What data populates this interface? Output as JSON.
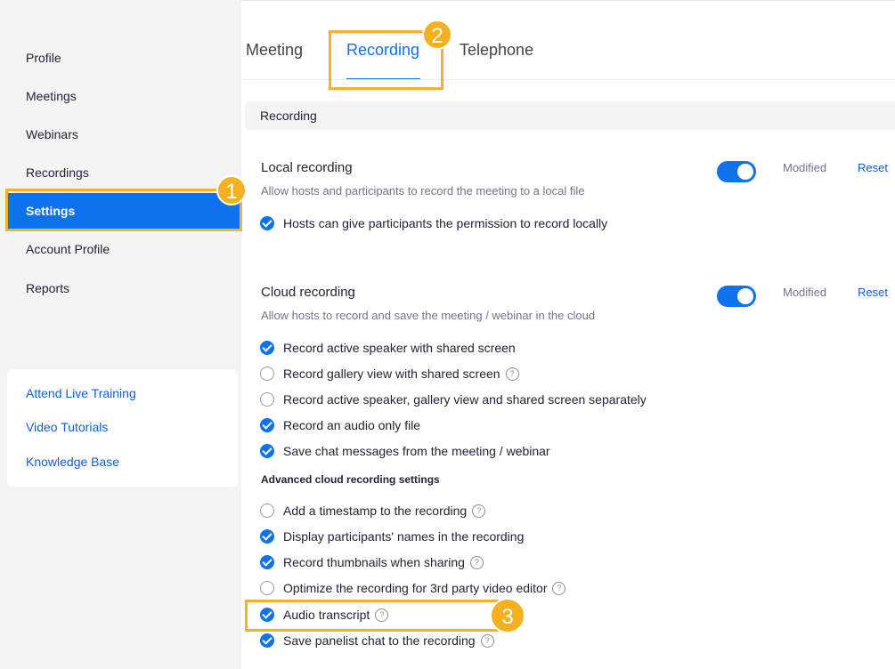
{
  "sidebar": {
    "items": [
      {
        "label": "Profile"
      },
      {
        "label": "Meetings"
      },
      {
        "label": "Webinars"
      },
      {
        "label": "Recordings"
      },
      {
        "label": "Settings",
        "active": true
      },
      {
        "label": "Account Profile"
      },
      {
        "label": "Reports"
      }
    ],
    "help_links": [
      "Attend Live Training",
      "Video Tutorials",
      "Knowledge Base"
    ]
  },
  "tabs": [
    "Meeting",
    "Recording",
    "Telephone"
  ],
  "section_header": "Recording",
  "local_recording": {
    "title": "Local recording",
    "description": "Allow hosts and participants to record the meeting to a local file",
    "enabled": true,
    "status": "Modified",
    "reset": "Reset",
    "options": [
      {
        "label": "Hosts can give participants the permission to record locally",
        "checked": true
      }
    ]
  },
  "cloud_recording": {
    "title": "Cloud recording",
    "description": "Allow hosts to record and save the meeting / webinar in the cloud",
    "enabled": true,
    "status": "Modified",
    "reset": "Reset",
    "options": [
      {
        "label": "Record active speaker with shared screen",
        "checked": true
      },
      {
        "label": "Record gallery view with shared screen",
        "checked": false,
        "help": true
      },
      {
        "label": "Record active speaker, gallery view and shared screen separately",
        "checked": false
      },
      {
        "label": "Record an audio only file",
        "checked": true
      },
      {
        "label": "Save chat messages from the meeting / webinar",
        "checked": true
      }
    ],
    "advanced_heading": "Advanced cloud recording settings",
    "advanced_options": [
      {
        "label": "Add a timestamp to the recording",
        "checked": false,
        "help": true
      },
      {
        "label": "Display participants' names in the recording",
        "checked": true
      },
      {
        "label": "Record thumbnails when sharing",
        "checked": true,
        "help": true
      },
      {
        "label": "Optimize the recording for 3rd party video editor",
        "checked": false,
        "help": true
      },
      {
        "label": "Audio transcript",
        "checked": true,
        "help": true
      },
      {
        "label": "Save panelist chat to the recording",
        "checked": true,
        "help": true
      }
    ]
  },
  "annotations": {
    "step1": "1",
    "step2": "2",
    "step3": "3"
  },
  "icons": {
    "help": "?"
  },
  "colors": {
    "accent": "#0e72ed",
    "highlight": "#f2b230"
  }
}
